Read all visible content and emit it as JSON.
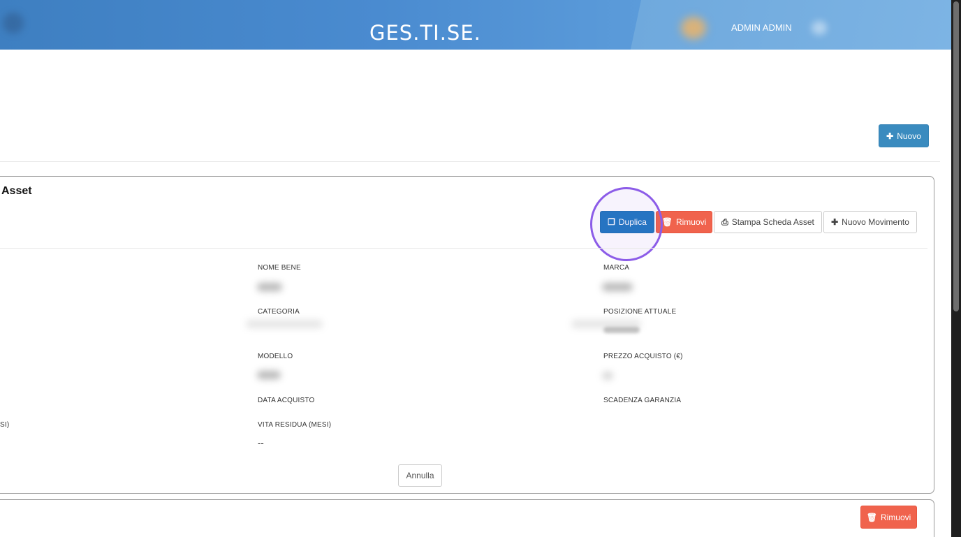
{
  "header": {
    "brand": "GES.TI.SE.",
    "user_name": "ADMIN ADMIN"
  },
  "toolbar": {
    "new_label": "Nuovo"
  },
  "card": {
    "title": "Asset",
    "actions": {
      "duplicate_label": "Duplica",
      "remove_label": "Rimuovi",
      "print_label": "Stampa Scheda Asset",
      "new_movement_label": "Nuovo Movimento"
    },
    "fields": {
      "nome_bene": "NOME BENE",
      "marca": "MARCA",
      "categoria": "CATEGORIA",
      "posizione_attuale": "POSIZIONE ATTUALE",
      "modello": "MODELLO",
      "prezzo_acquisto": "PREZZO ACQUISTO (€)",
      "data_acquisto": "DATA ACQUISTO",
      "scadenza_garanzia": "SCADENZA GARANZIA",
      "vita_residua": "VITA RESIDUA (MESI)",
      "vita_residua_value": "--",
      "left_cut_label": "SI)"
    },
    "cancel_label": "Annulla"
  },
  "card2": {
    "remove_label": "Rimuovi"
  },
  "colors": {
    "primary": "#1f77c0",
    "danger": "#f0634d",
    "nuovo": "#3a8bbf",
    "highlight": "#8c5ce8"
  }
}
